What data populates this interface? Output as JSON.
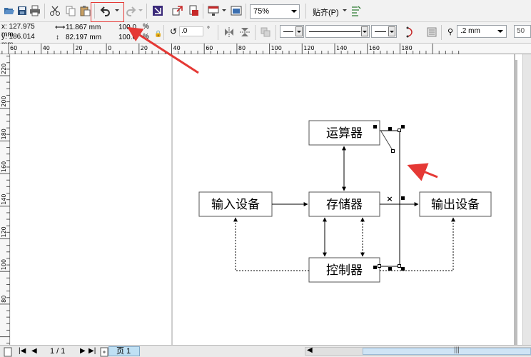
{
  "toolbar": {
    "zoom_value": "75%",
    "snap_label": "贴齐(P)"
  },
  "property_bar": {
    "x_value": "x: 127.975 mm",
    "y_value": "y: 186.014 mm",
    "width_value": "11.867 mm",
    "height_value": "82.197 mm",
    "scale_x": "100.0",
    "scale_y": "100.0",
    "percent": "%",
    "rotation": ".0",
    "degree": "°",
    "outline_width": ".2 mm",
    "right_value": "50"
  },
  "ruler": {
    "h_labels": [
      "60",
      "40",
      "20",
      "0",
      "20",
      "40",
      "60",
      "80",
      "100",
      "120",
      "140",
      "160",
      "180"
    ],
    "v_labels": [
      "220",
      "200",
      "180",
      "160",
      "140",
      "120",
      "100",
      "80"
    ]
  },
  "diagram": {
    "alu": "运算器",
    "memory": "存储器",
    "input": "输入设备",
    "output": "输出设备",
    "control": "控制器",
    "marker": "×"
  },
  "status": {
    "page_count": "1 / 1",
    "page_tab": "页 1"
  },
  "colors": {
    "annotation": "#e53935",
    "highlight_tab": "#bfe0f4"
  }
}
